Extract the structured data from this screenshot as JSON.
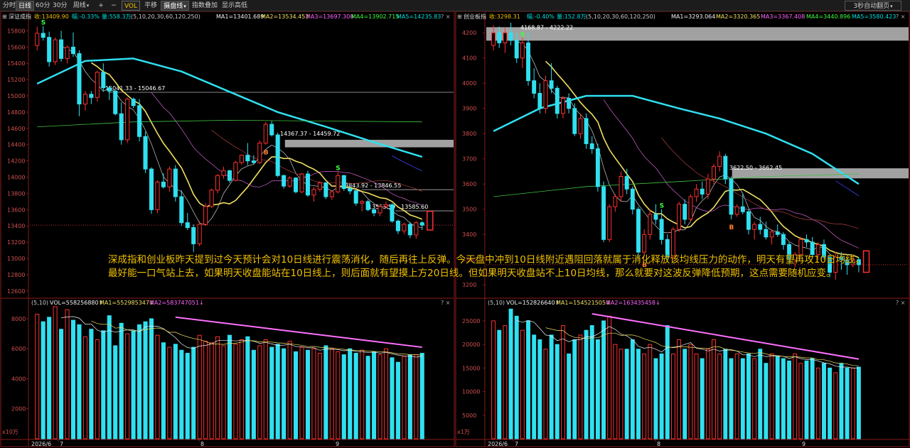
{
  "toolbar": {
    "items": [
      {
        "label": "分时",
        "active": false
      },
      {
        "label": "日线",
        "active": true
      },
      {
        "label": "60分",
        "active": false
      },
      {
        "label": "30分",
        "active": false
      },
      {
        "label": "周线",
        "active": false,
        "dropdown": true
      },
      {
        "label": "+",
        "active": false
      },
      {
        "label": "−",
        "active": false
      },
      {
        "label": "VOL",
        "active": false,
        "vol": true
      },
      {
        "label": "平移",
        "active": false
      },
      {
        "label": "摄盘线",
        "active": true,
        "dropdown": true
      },
      {
        "label": "指数叠加",
        "active": false
      },
      {
        "label": "显示高低",
        "active": false
      }
    ],
    "right": {
      "label": "3秒自动翻页"
    }
  },
  "comment": "深成指和创业板昨天提到过今天预计会对10日线进行震荡消化，随后再往上反弹。今天盘中冲到10日线附近遇阻回落就属于消化释放该均线压力的动作，明天有望再攻10日均线，最好能一口气站上去，如果明天收盘能站在10日线上，则后面就有望摸上方20日线。但如果明天收盘站不上10日均线，那么就要对这波反弹降低预期，这点需要随机应变。",
  "chart_data": [
    {
      "type": "candlestick",
      "index_name": "深证成指",
      "header": {
        "close": "收:13409.90",
        "change": "幅:-0.33%",
        "volume": "量:558.3万",
        "periods": "(5,10,20,30,60,120,250)",
        "ma1": "MA1=13401.689",
        "ma2": "MA2=13534.453",
        "ma3": "MA3=13697.308",
        "ma4": "MA4=13902.715",
        "ma5": "MA5=14235.83"
      },
      "y_ticks": [
        15800,
        15600,
        15400,
        15200,
        15000,
        14800,
        14600,
        14400,
        14200,
        14000,
        13800,
        13600,
        13400,
        13200,
        13000,
        12800,
        12600
      ],
      "y_ticks_labels": [
        "15800",
        "15600",
        "15400",
        "15200",
        "15000",
        "14800",
        "14600",
        "14400",
        "14200",
        "14000",
        "13800",
        "13600",
        "13400",
        "13200",
        "13000",
        "12800",
        "12600"
      ],
      "ylim": [
        12520,
        15900
      ],
      "x_labels": [
        "2026/6",
        "7",
        "8",
        "9"
      ],
      "annotations": {
        "a1": "15041.33 - 15046.67",
        "a2": "14367.37 - 14459.72",
        "a3": "13843.92 - 13846.55",
        "a4": "13553.59 - 13585.60"
      },
      "zones": [
        {
          "low": 14367.37,
          "high": 14459.72
        },
        {
          "low": 13843.92,
          "high": 13846.55
        },
        {
          "low": 13553.59,
          "high": 13585.6
        }
      ],
      "s_marks": [
        1,
        50
      ],
      "b_marks": [
        38
      ],
      "candles": [
        [
          15620,
          15850,
          15560,
          15770
        ],
        [
          15770,
          15860,
          15680,
          15720
        ],
        [
          15720,
          15790,
          15360,
          15420
        ],
        [
          15420,
          15720,
          15380,
          15690
        ],
        [
          15690,
          15800,
          15420,
          15460
        ],
        [
          15460,
          15620,
          15400,
          15600
        ],
        [
          15600,
          15780,
          15480,
          15520
        ],
        [
          15520,
          15560,
          14750,
          14900
        ],
        [
          14900,
          15060,
          14820,
          15020
        ],
        [
          15020,
          15060,
          14900,
          14980
        ],
        [
          14980,
          15310,
          14930,
          15290
        ],
        [
          15290,
          15400,
          15050,
          15100
        ],
        [
          15100,
          15120,
          14950,
          15060
        ],
        [
          15060,
          15070,
          14760,
          14780
        ],
        [
          14780,
          14920,
          14400,
          14460
        ],
        [
          14460,
          14980,
          14420,
          14960
        ],
        [
          14960,
          14980,
          14850,
          14880
        ],
        [
          14880,
          14960,
          14440,
          14500
        ],
        [
          14500,
          14560,
          14050,
          14100
        ],
        [
          14100,
          14120,
          13550,
          13600
        ],
        [
          13600,
          13960,
          13560,
          13940
        ],
        [
          13940,
          14050,
          13860,
          13880
        ],
        [
          13880,
          14130,
          13820,
          14100
        ],
        [
          14100,
          14150,
          13700,
          13760
        ],
        [
          13760,
          13840,
          13400,
          13440
        ],
        [
          13440,
          13560,
          13350,
          13380
        ],
        [
          13380,
          13420,
          13080,
          13180
        ],
        [
          13180,
          13460,
          13150,
          13420
        ],
        [
          13420,
          13680,
          13400,
          13640
        ],
        [
          13640,
          13860,
          13620,
          13840
        ],
        [
          13840,
          14040,
          13800,
          14020
        ],
        [
          14020,
          14130,
          13980,
          14080
        ],
        [
          14080,
          14090,
          13930,
          13960
        ],
        [
          13960,
          14200,
          13950,
          14180
        ],
        [
          14180,
          14280,
          14150,
          14270
        ],
        [
          14270,
          14420,
          14150,
          14200
        ],
        [
          14200,
          14270,
          14160,
          14180
        ],
        [
          14180,
          14450,
          14160,
          14420
        ],
        [
          14420,
          14680,
          14400,
          14650
        ],
        [
          14650,
          14690,
          14500,
          14520
        ],
        [
          14520,
          14550,
          14000,
          14020
        ],
        [
          14020,
          14030,
          13860,
          13890
        ],
        [
          13890,
          14010,
          13870,
          13990
        ],
        [
          13990,
          14000,
          13800,
          13820
        ],
        [
          13820,
          14050,
          13800,
          14040
        ],
        [
          14040,
          14080,
          13760,
          13780
        ],
        [
          13780,
          13880,
          13700,
          13850
        ],
        [
          13850,
          13950,
          13820,
          13930
        ],
        [
          13930,
          13940,
          13730,
          13760
        ],
        [
          13760,
          13840,
          13720,
          13820
        ],
        [
          13820,
          14070,
          13800,
          14020
        ],
        [
          14020,
          14030,
          13830,
          13860
        ],
        [
          13860,
          13890,
          13790,
          13830
        ],
        [
          13830,
          13840,
          13650,
          13680
        ],
        [
          13680,
          13720,
          13580,
          13700
        ],
        [
          13700,
          13720,
          13580,
          13600
        ],
        [
          13600,
          13620,
          13520,
          13560
        ],
        [
          13560,
          13660,
          13520,
          13640
        ],
        [
          13640,
          13700,
          13620,
          13660
        ],
        [
          13660,
          13680,
          13440,
          13460
        ],
        [
          13460,
          13480,
          13300,
          13340
        ],
        [
          13340,
          13440,
          13300,
          13420
        ],
        [
          13420,
          13450,
          13250,
          13290
        ],
        [
          13290,
          13460,
          13240,
          13440
        ],
        [
          13440,
          13460,
          13350,
          13410
        ]
      ],
      "volume": {
        "header": {
          "periods": "(5,10)",
          "vol": "VOL=558256880↑",
          "ma1": "MA1=552985347↓",
          "ma2": "MA2=583747051↓"
        },
        "y_ticks": [
          8000,
          6000,
          4000,
          2000
        ],
        "y_ticks_labels": [
          "8000",
          "6000",
          "4000",
          "2000"
        ],
        "ylim": [
          0,
          8800
        ],
        "unit": "x10万",
        "values": [
          8300,
          7800,
          8100,
          8800,
          7300,
          8600,
          7900,
          7600,
          6800,
          7300,
          6600,
          7200,
          8200,
          6200,
          7700,
          7000,
          7200,
          7600,
          7800,
          8000,
          6900,
          6400,
          6100,
          6300,
          5900,
          5700,
          6100,
          6900,
          6500,
          6400,
          6800,
          6200,
          6900,
          6300,
          6600,
          6800,
          5900,
          6200,
          6600,
          6100,
          6300,
          6000,
          6500,
          5800,
          6100,
          5900,
          6000,
          5700,
          6200,
          6000,
          5800,
          5600,
          6000,
          5700,
          5900,
          5500,
          5800,
          5600,
          6000,
          5400,
          5100,
          5500,
          5600,
          5600,
          5700
        ]
      },
      "pink_line": {
        "from": [
          23,
          8100
        ],
        "to": [
          65,
          6100
        ]
      }
    },
    {
      "type": "candlestick",
      "index_name": "创业板指",
      "header": {
        "close": "收:3298.31",
        "change": "幅:-0.40%",
        "volume": "量:152.8万",
        "periods": "(5,10,20,30,60,120,250)",
        "ma1": "MA1=3293.064",
        "ma2": "MA2=3320.365",
        "ma3": "MA3=3367.408",
        "ma4": "MA4=3440.896",
        "ma5": "MA5=3580.423"
      },
      "y_ticks": [
        4200,
        4100,
        4000,
        3900,
        3800,
        3700,
        3600,
        3500,
        3400,
        3300,
        3200
      ],
      "y_ticks_labels": [
        "4200",
        "4100",
        "4000",
        "3900",
        "3800",
        "3700",
        "3600",
        "3500",
        "3400",
        "3300",
        "3200"
      ],
      "ylim": [
        3150,
        4240
      ],
      "x_labels": [
        "2026/6",
        "7",
        "8",
        "9"
      ],
      "annotations": {
        "a1": "4168.87 - 4222.22",
        "a2": "3622.50 - 3662.45"
      },
      "zones": [
        {
          "low": 4168.87,
          "high": 4222.22
        },
        {
          "low": 3622.5,
          "high": 3662.45
        }
      ],
      "s_marks": [
        5,
        29
      ],
      "b_marks": [
        26,
        41
      ],
      "candles": [
        [
          4150,
          4230,
          4130,
          4200
        ],
        [
          4200,
          4225,
          4140,
          4160
        ],
        [
          4160,
          4220,
          4120,
          4200
        ],
        [
          4200,
          4240,
          4150,
          4170
        ],
        [
          4170,
          4200,
          4080,
          4100
        ],
        [
          4100,
          4180,
          4060,
          4160
        ],
        [
          4160,
          4200,
          3990,
          4010
        ],
        [
          4010,
          4060,
          3940,
          3960
        ],
        [
          3960,
          4000,
          3880,
          3900
        ],
        [
          3900,
          4030,
          3880,
          4010
        ],
        [
          4010,
          4080,
          3960,
          3980
        ],
        [
          3980,
          3990,
          3860,
          3880
        ],
        [
          3880,
          3950,
          3860,
          3940
        ],
        [
          3940,
          3960,
          3880,
          3900
        ],
        [
          3900,
          3920,
          3790,
          3800
        ],
        [
          3800,
          3880,
          3780,
          3860
        ],
        [
          3860,
          3880,
          3740,
          3760
        ],
        [
          3760,
          3790,
          3720,
          3740
        ],
        [
          3740,
          3760,
          3570,
          3590
        ],
        [
          3590,
          3610,
          3370,
          3380
        ],
        [
          3380,
          3520,
          3370,
          3510
        ],
        [
          3510,
          3560,
          3490,
          3550
        ],
        [
          3550,
          3650,
          3530,
          3630
        ],
        [
          3630,
          3660,
          3560,
          3580
        ],
        [
          3580,
          3590,
          3480,
          3500
        ],
        [
          3500,
          3510,
          3300,
          3330
        ],
        [
          3330,
          3420,
          3310,
          3400
        ],
        [
          3400,
          3500,
          3380,
          3480
        ],
        [
          3480,
          3520,
          3440,
          3460
        ],
        [
          3460,
          3500,
          3360,
          3380
        ],
        [
          3380,
          3400,
          3290,
          3310
        ],
        [
          3310,
          3430,
          3300,
          3420
        ],
        [
          3420,
          3530,
          3410,
          3520
        ],
        [
          3520,
          3540,
          3440,
          3460
        ],
        [
          3460,
          3560,
          3450,
          3550
        ],
        [
          3550,
          3600,
          3530,
          3580
        ],
        [
          3580,
          3610,
          3540,
          3560
        ],
        [
          3560,
          3640,
          3540,
          3620
        ],
        [
          3620,
          3680,
          3600,
          3670
        ],
        [
          3670,
          3730,
          3650,
          3710
        ],
        [
          3710,
          3720,
          3600,
          3620
        ],
        [
          3620,
          3630,
          3460,
          3480
        ],
        [
          3480,
          3520,
          3470,
          3510
        ],
        [
          3510,
          3560,
          3480,
          3490
        ],
        [
          3490,
          3500,
          3400,
          3420
        ],
        [
          3420,
          3450,
          3380,
          3440
        ],
        [
          3440,
          3470,
          3400,
          3420
        ],
        [
          3420,
          3450,
          3380,
          3390
        ],
        [
          3390,
          3420,
          3360,
          3410
        ],
        [
          3410,
          3440,
          3390,
          3400
        ],
        [
          3400,
          3410,
          3340,
          3360
        ],
        [
          3360,
          3370,
          3280,
          3300
        ],
        [
          3300,
          3330,
          3270,
          3320
        ],
        [
          3320,
          3390,
          3310,
          3380
        ],
        [
          3380,
          3400,
          3350,
          3370
        ],
        [
          3370,
          3390,
          3310,
          3320
        ],
        [
          3320,
          3370,
          3300,
          3360
        ],
        [
          3360,
          3380,
          3300,
          3310
        ],
        [
          3310,
          3320,
          3230,
          3250
        ],
        [
          3250,
          3330,
          3220,
          3310
        ],
        [
          3310,
          3330,
          3260,
          3300
        ],
        [
          3300,
          3310,
          3240,
          3280
        ],
        [
          3280,
          3320,
          3270,
          3300
        ],
        [
          3300,
          3310,
          3250,
          3280
        ]
      ],
      "volume": {
        "header": {
          "periods": "(5,10)",
          "vol": "VOL=152826640↑",
          "ma1": "MA1=154521505↓",
          "ma2": "MA2=163435458↓"
        },
        "y_ticks": [
          25000,
          20000,
          15000,
          10000,
          5000
        ],
        "y_ticks_labels": [
          "25000",
          "20000",
          "15000",
          "10000",
          "5000"
        ],
        "ylim": [
          0,
          28000
        ],
        "unit": "x1万",
        "values": [
          25000,
          23000,
          24000,
          27500,
          26000,
          23000,
          25000,
          22000,
          21000,
          19000,
          22000,
          20000,
          24000,
          18000,
          21000,
          22000,
          23000,
          24000,
          21000,
          25000,
          26000,
          20000,
          19000,
          19000,
          21000,
          19000,
          18000,
          20000,
          17000,
          18000,
          24000,
          18000,
          21000,
          19000,
          20000,
          18000,
          17000,
          19000,
          21000,
          18000,
          19000,
          17000,
          18000,
          17000,
          18000,
          17000,
          19000,
          16000,
          18000,
          17500,
          17000,
          16500,
          18000,
          16000,
          16500,
          17000,
          15000,
          16000,
          15000,
          14000,
          16000,
          15000,
          15000,
          15200
        ]
      },
      "pink_line": {
        "from": [
          17,
          26500
        ],
        "to": [
          64,
          16900
        ]
      }
    }
  ]
}
